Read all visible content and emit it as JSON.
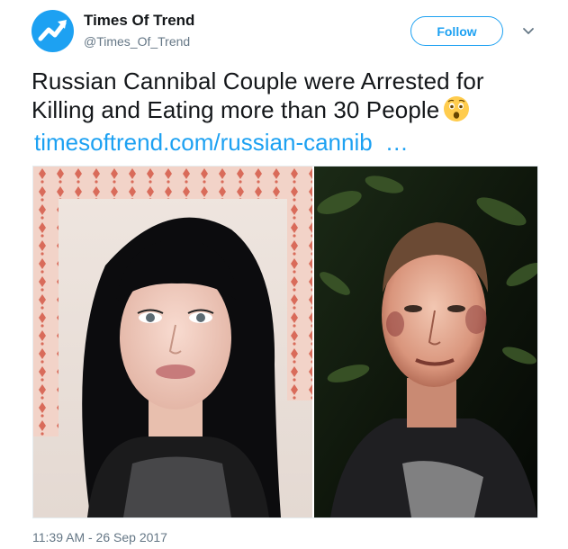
{
  "tweet": {
    "author": {
      "display_name": "Times Of Trend",
      "handle": "@Times_Of_Trend",
      "avatar_icon": "trend-arrow-icon",
      "avatar_color": "#1da1f2"
    },
    "follow_label": "Follow",
    "caret_icon": "chevron-down-icon",
    "text": "Russian Cannibal Couple were Arrested for Killing and Eating more than 30 People",
    "emoji_icon": "astonished-face-emoji",
    "link_text": "timesoftrend.com/russian-cannib",
    "link_ellipsis": "…",
    "timestamp": "11:39 AM - 26 Sep 2017",
    "media": {
      "left_photo": "woman-passport-photo",
      "right_photo": "man-bruised-face-photo"
    },
    "colors": {
      "accent": "#1da1f2",
      "secondary_text": "#657786",
      "primary_text": "#14171a"
    }
  }
}
